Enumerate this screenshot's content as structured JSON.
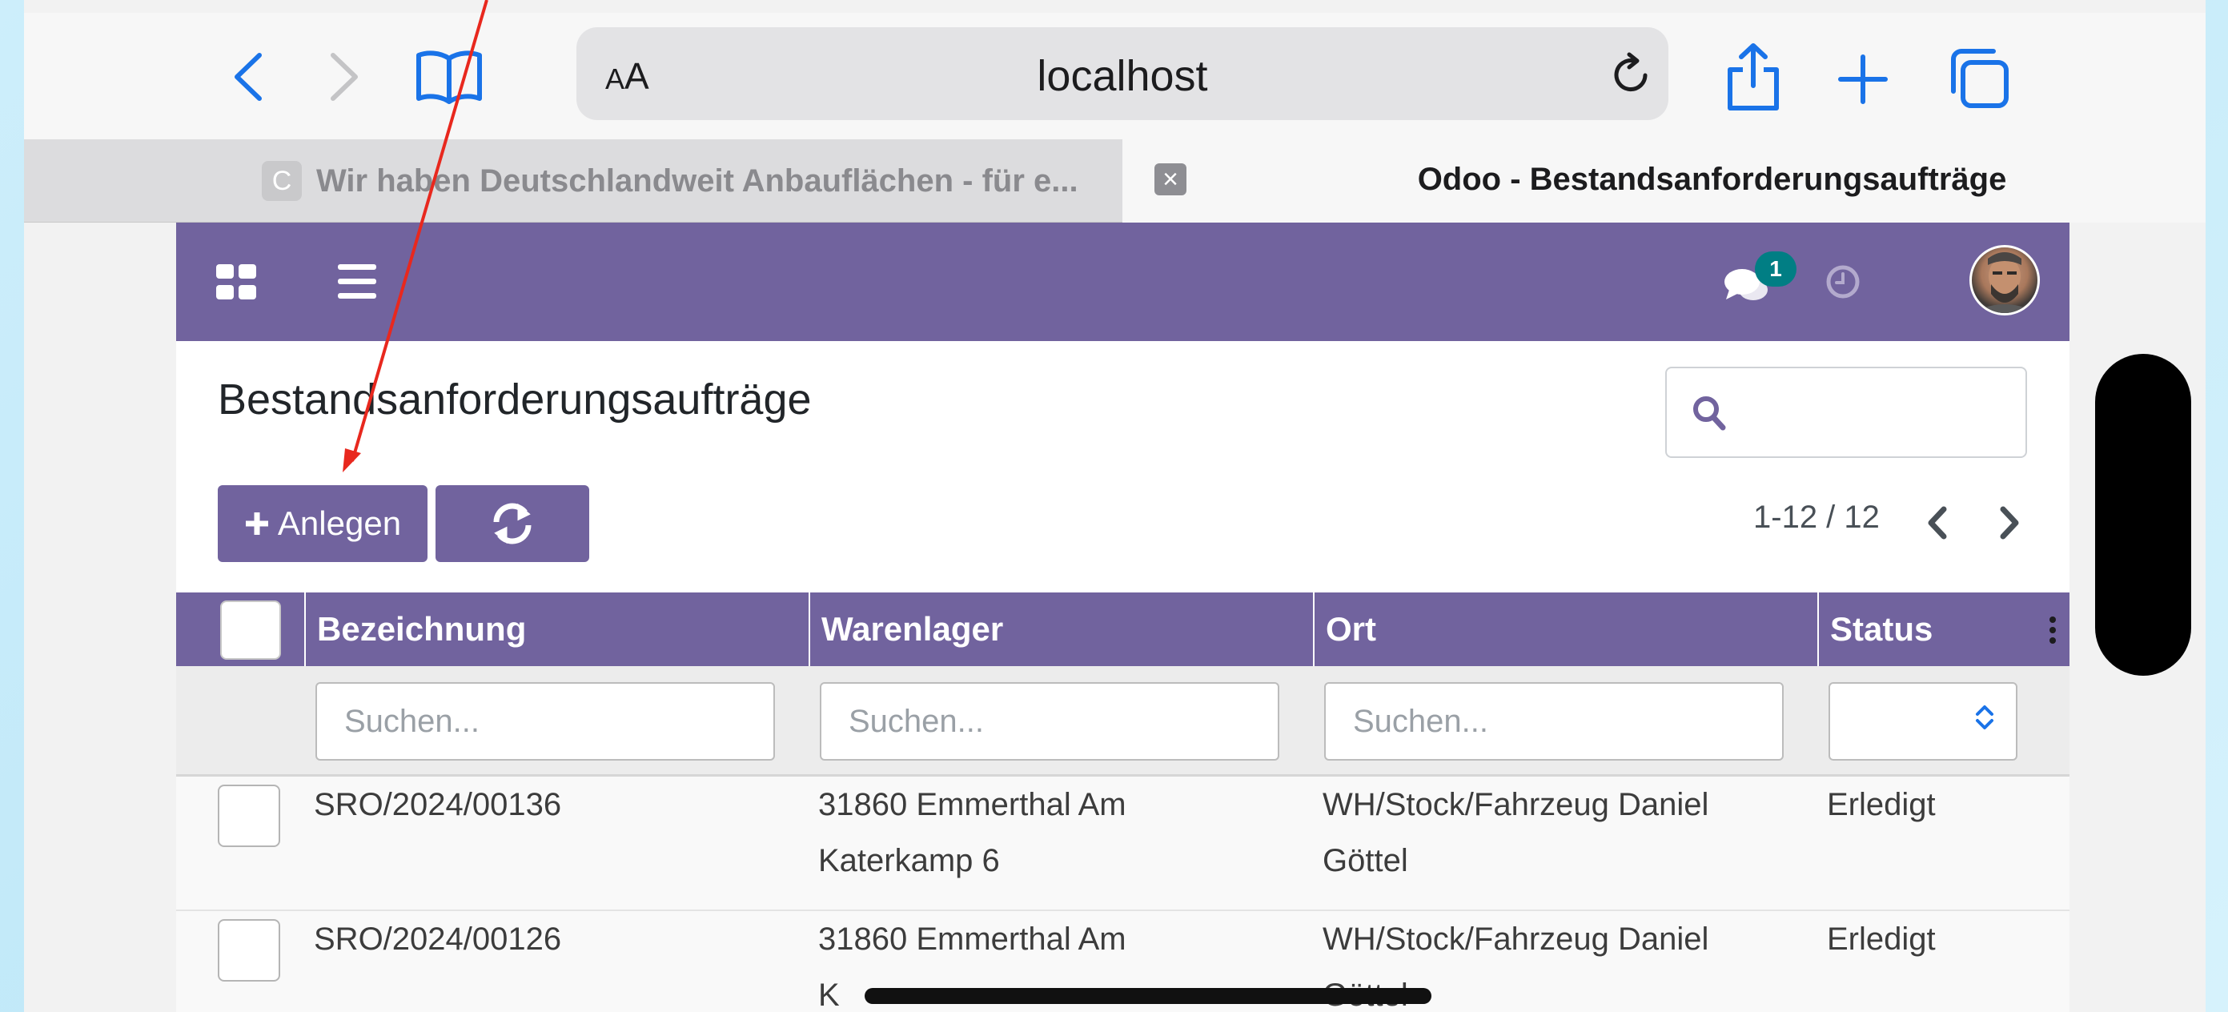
{
  "browser": {
    "reader_label_small": "A",
    "reader_label_large": "A",
    "url": "localhost",
    "tabs": [
      {
        "favicon": "C",
        "title": "Wir haben Deutschlandweit Anbauflächen - für e..."
      },
      {
        "title": "Odoo - Bestandsanforderungsaufträge"
      }
    ]
  },
  "navbar": {
    "chat_badge": "1",
    "accent": "#71639e"
  },
  "page": {
    "title": "Bestandsanforderungsaufträge",
    "create_label": "Anlegen",
    "pager": "1-12 / 12"
  },
  "table": {
    "columns": [
      "Bezeichnung",
      "Warenlager",
      "Ort",
      "Status"
    ],
    "filter_placeholder": "Suchen...",
    "rows": [
      {
        "name": "SRO/2024/00136",
        "warehouse_l1": "31860 Emmerthal Am",
        "warehouse_l2": "Katerkamp 6",
        "location_l1": "WH/Stock/Fahrzeug Daniel",
        "location_l2": "Göttel",
        "status": "Erledigt"
      },
      {
        "name": "SRO/2024/00126",
        "warehouse_l1": "31860 Emmerthal Am",
        "warehouse_l2": "K",
        "location_l1": "WH/Stock/Fahrzeug Daniel",
        "location_l2": "Göttel",
        "status": "Erledigt"
      }
    ]
  },
  "icons": [
    "back-icon",
    "forward-icon",
    "bookmarks-icon",
    "reload-icon",
    "share-icon",
    "new-tab-icon",
    "tabs-icon",
    "apps-icon",
    "menu-icon",
    "chat-icon",
    "clock-icon",
    "search-icon",
    "plus-icon",
    "refresh-icon",
    "chevron-left-icon",
    "chevron-right-icon",
    "kebab-icon",
    "select-arrows-icon"
  ]
}
